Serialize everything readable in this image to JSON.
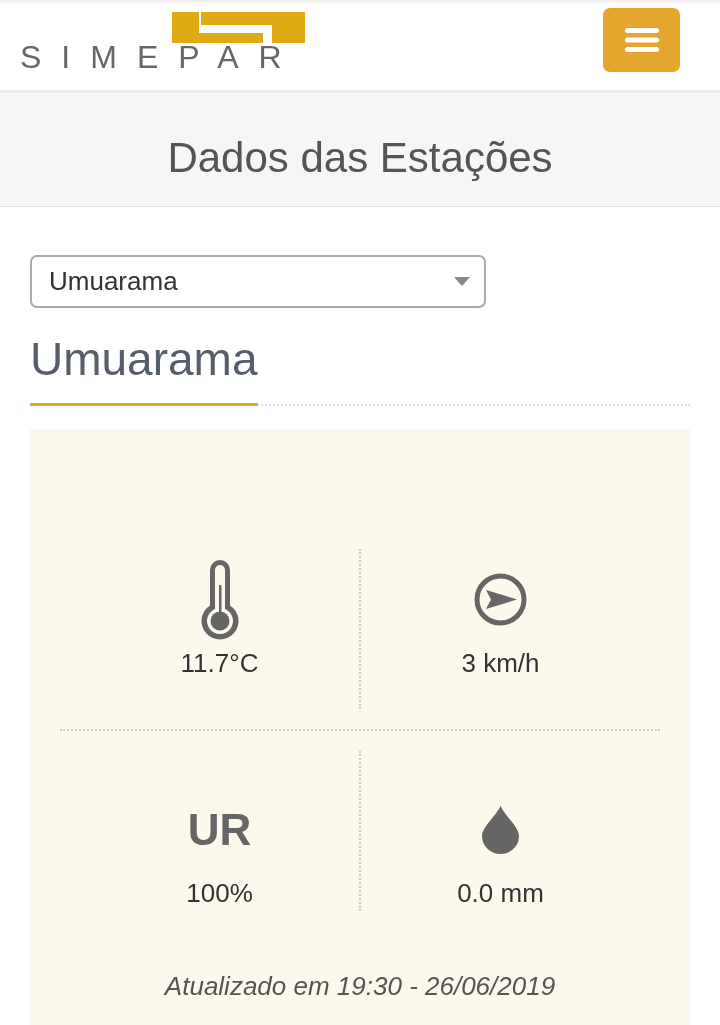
{
  "header": {
    "logo_text": "SIMEPAR"
  },
  "page_title": "Dados das Estações",
  "station_select": {
    "value": "Umuarama"
  },
  "station_heading": "Umuarama",
  "readings": [
    {
      "kind": "temperature",
      "value": "11.7°C"
    },
    {
      "kind": "wind",
      "value": "3 km/h"
    },
    {
      "kind": "humidity",
      "label": "UR",
      "value": "100%"
    },
    {
      "kind": "rain",
      "value": "0.0 mm"
    }
  ],
  "updated": "Atualizado em 19:30 - 26/06/2019"
}
